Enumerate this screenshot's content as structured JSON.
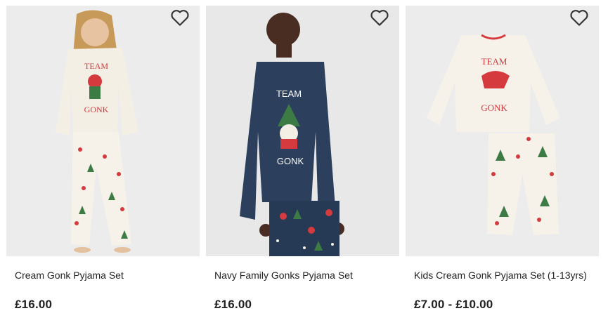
{
  "products": [
    {
      "title": "Cream Gonk Pyjama Set",
      "price": "£16.00",
      "graphic_text_top": "TEAM",
      "graphic_text_bottom": "GONK",
      "wishlist_icon": "heart-outline-icon"
    },
    {
      "title": "Navy Family Gonks Pyjama Set",
      "price": "£16.00",
      "graphic_text_top": "TEAM",
      "graphic_text_bottom": "GONK",
      "wishlist_icon": "heart-outline-icon"
    },
    {
      "title": "Kids Cream Gonk Pyjama Set (1-13yrs)",
      "price": "£7.00 - £10.00",
      "graphic_text_top": "TEAM",
      "graphic_text_bottom": "GONK",
      "wishlist_icon": "heart-outline-icon"
    }
  ],
  "colors": {
    "cream": "#f3efe4",
    "navy": "#2c3f5c",
    "accent_red": "#d43a3e",
    "tree_green": "#3c7c44",
    "image_bg": "#ececec"
  }
}
